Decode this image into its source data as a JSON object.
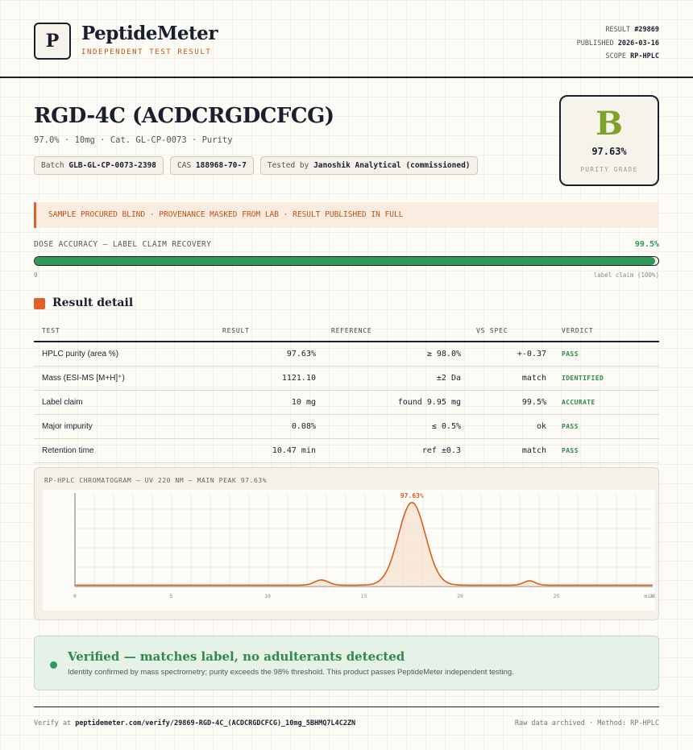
{
  "header": {
    "logo_letter": "P",
    "brand_name": "PeptideMeter",
    "brand_tagline": "INDEPENDENT TEST RESULT",
    "result_label": "RESULT",
    "result_value": "#29869",
    "published_label": "PUBLISHED",
    "published_value": "2026-03-16",
    "scope_label": "SCOPE",
    "scope_value": "RP-HPLC"
  },
  "product": {
    "title": "RGD-4C (ACDCRGDCFCG)",
    "subtitle": "97.0% · 10mg · Cat. GL-CP-0073 · Purity",
    "batch_label": "Batch",
    "batch_value": "GLB-GL-CP-0073-2398",
    "cas_label": "CAS",
    "cas_value": "188968-70-7",
    "tested_label": "Tested by",
    "tested_value": "Janoshik Analytical (commissioned)"
  },
  "grade": {
    "letter": "B",
    "value": "97.63%",
    "label": "PURITY GRADE",
    "color": "#7ea12a"
  },
  "notice": {
    "text": "SAMPLE PROCURED BLIND · PROVENANCE MASKED FROM LAB · RESULT PUBLISHED IN FULL"
  },
  "dose": {
    "label": "DOSE ACCURACY — LABEL CLAIM RECOVERY",
    "value": "99.5%",
    "fraction": 0.995,
    "min_label": "0",
    "max_label": "label claim (100%)",
    "color": "#2e9a57"
  },
  "section_title": "Result detail",
  "table": {
    "headers": [
      "TEST",
      "RESULT",
      "REFERENCE",
      "VS SPEC",
      "VERDICT"
    ],
    "rows": [
      {
        "test": "HPLC purity (area %)",
        "result": "97.63%",
        "reference": "≥ 98.0%",
        "vs": "+-0.37",
        "verdict": "PASS"
      },
      {
        "test": "Mass (ESI-MS [M+H]⁺)",
        "result": "1121.10",
        "reference": "±2 Da",
        "vs": "match",
        "verdict": "IDENTIFIED"
      },
      {
        "test": "Label claim",
        "result": "10 mg",
        "reference": "found 9.95 mg",
        "vs": "99.5%",
        "verdict": "ACCURATE"
      },
      {
        "test": "Major impurity",
        "result": "0.08%",
        "reference": "≤ 0.5%",
        "vs": "ok",
        "verdict": "PASS"
      },
      {
        "test": "Retention time",
        "result": "10.47 min",
        "reference": "ref ±0.3",
        "vs": "match",
        "verdict": "PASS"
      }
    ]
  },
  "chromatogram": {
    "title": "RP-HPLC CHROMATOGRAM — UV 220 NM — MAIN PEAK 97.63%"
  },
  "chart_data": {
    "type": "line",
    "title": "RP-HPLC CHROMATOGRAM — UV 220 NM — MAIN PEAK 97.63%",
    "xlabel": "min",
    "ylabel": "",
    "xlim": [
      0,
      30
    ],
    "ylim": [
      0,
      100
    ],
    "xticks": [
      0,
      5,
      10,
      15,
      20,
      25,
      30
    ],
    "xtick_labels": [
      "0",
      "5",
      "10",
      "15",
      "20",
      "25",
      "30"
    ],
    "peak_annotation": "97.63%",
    "peaks": [
      {
        "rt": 12.8,
        "height": 6,
        "width": 0.35
      },
      {
        "rt": 17.5,
        "height": 95,
        "width": 0.7
      },
      {
        "rt": 23.6,
        "height": 5,
        "width": 0.3
      }
    ],
    "baseline": 1.5,
    "grid": true,
    "color": "#d9601a"
  },
  "verified": {
    "title": "Verified — matches label, no adulterants detected",
    "description": "Identity confirmed by mass spectrometry; purity exceeds the 98% threshold. This product passes PeptideMeter independent testing."
  },
  "footer": {
    "verify_prefix": "Verify at",
    "verify_url": "peptidemeter.com/verify/29869-RGD-4C_(ACDCRGDCFCG)_10mg_5BHMQ7L4C2ZN",
    "right_text": "Raw data archived · Method: RP-HPLC"
  }
}
